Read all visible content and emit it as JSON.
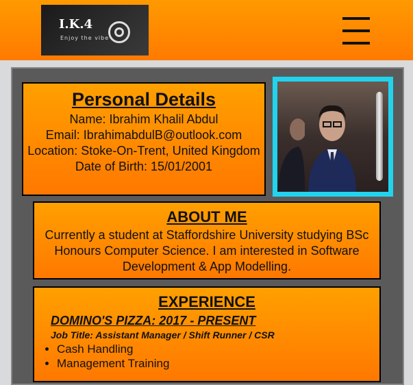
{
  "header": {
    "logo_text": "I.K.4",
    "logo_tagline": "Enjoy the vibe"
  },
  "personal": {
    "title": "Personal Details",
    "name": "Name: Ibrahim Khalil Abdul",
    "email": "Email: IbrahimabdulB@outlook.com",
    "location": "Location: Stoke-On-Trent, United Kingdom",
    "dob": "Date of Birth: 15/01/2001"
  },
  "about": {
    "title": "ABOUT ME",
    "text": "Currently a student at Staffordshire University studying BSc Honours Computer Science. I am interested in Software Development & App Modelling."
  },
  "experience": {
    "title": "EXPERIENCE",
    "company": "DOMINO'S PIZZA: 2017 - PRESENT",
    "job_title": "Job Title: Assistant Manager / Shift Runner / CSR",
    "items": [
      "Cash Handling",
      "Management Training"
    ]
  },
  "colors": {
    "accent": "#ff8c00",
    "photo_border": "#22d3ee"
  }
}
